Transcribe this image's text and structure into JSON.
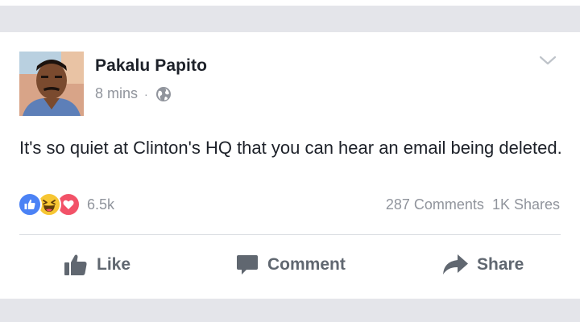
{
  "post": {
    "author": "Pakalu Papito",
    "time": "8 mins",
    "separator": "·",
    "text": "It's so quiet at Clinton's HQ that you can hear an email being deleted.",
    "privacy_icon": "globe-icon",
    "menu_icon": "chevron-down-icon"
  },
  "reactions": {
    "types": [
      "like",
      "haha",
      "love"
    ],
    "count": "6.5k"
  },
  "stats": {
    "comments": "287 Comments",
    "shares": "1K Shares"
  },
  "actions": {
    "like": "Like",
    "comment": "Comment",
    "share": "Share"
  },
  "colors": {
    "like_blue": "#4b82f5",
    "haha_yellow": "#f7c633",
    "love_red": "#f25268",
    "text_primary": "#1d2129",
    "text_secondary": "#90949c",
    "action_gray": "#606770",
    "background": "#e4e5ea"
  }
}
